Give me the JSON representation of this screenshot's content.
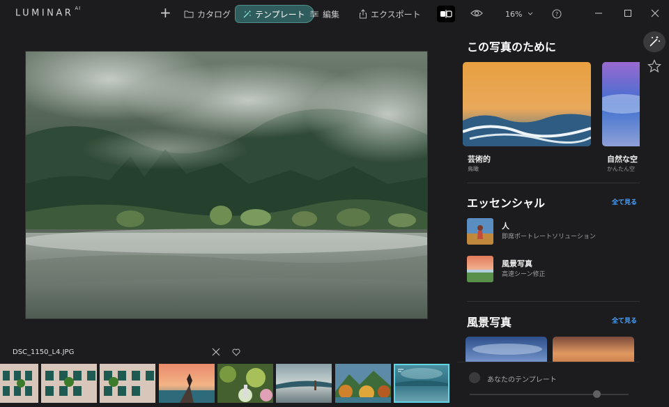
{
  "app": {
    "logo": "LUMINAR",
    "logo_ai": "AI"
  },
  "toolbar": {
    "add_label": "+",
    "catalog_label": "カタログ",
    "template_label": "テンプレート",
    "edit_label": "編集",
    "export_label": "エクスポート",
    "zoom_label": "16%"
  },
  "filmstrip": {
    "filename": "DSC_1150_L4.JPG",
    "selected_index": 7
  },
  "panel": {
    "for_photo_title": "この写真のために",
    "cards": [
      {
        "name": "芸術的",
        "sub": "鳥瞰"
      },
      {
        "name": "自然な空",
        "sub": "かんたん空"
      }
    ],
    "essentials_title": "エッセンシャル",
    "essentials_see_all": "全て見る",
    "essentials": [
      {
        "name": "人",
        "sub": "即席ポートレートソリューション"
      },
      {
        "name": "風景写真",
        "sub": "高速シーン修正"
      }
    ],
    "landscape_title": "風景写真",
    "landscape_see_all": "全て見る",
    "your_templates_label": "あなたのテンプレート",
    "slider_value": 0.8
  },
  "colors": {
    "accent": "#4aa3ff",
    "template_active": "#2f5c5c",
    "selected_thumb": "#5fd5e8"
  }
}
